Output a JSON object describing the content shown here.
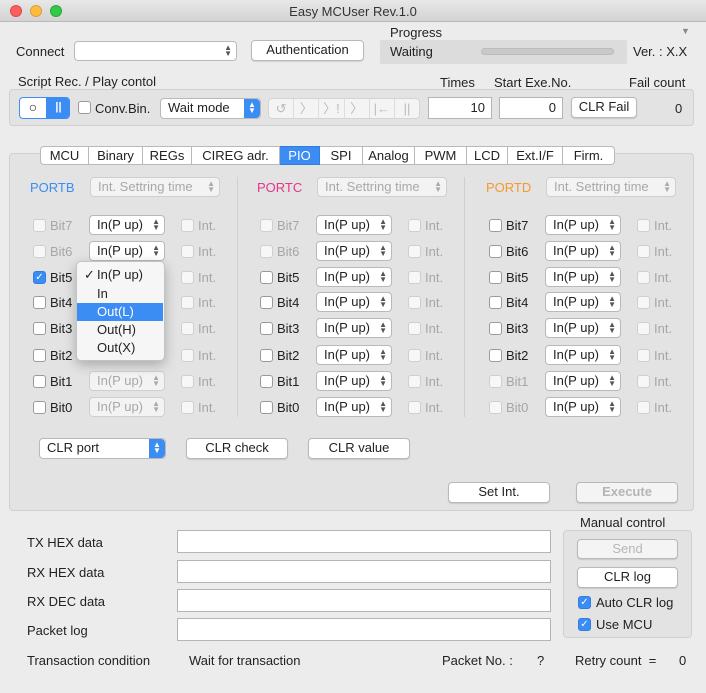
{
  "window": {
    "title": "Easy MCUser Rev.1.0"
  },
  "header": {
    "connect_label": "Connect",
    "connect_value": "",
    "auth_button": "Authentication",
    "progress_label": "Progress",
    "progress_status": "Waiting",
    "progress_fraction": 0,
    "version": "Ver. : X.X"
  },
  "script": {
    "label": "Script Rec. / Play contol",
    "times_label": "Times",
    "start_label": "Start Exe.No.",
    "fail_label": "Fail count",
    "conv_label": "Conv.Bin.",
    "mode_value": "Wait mode",
    "times_value": "10",
    "start_value": "0",
    "clr_fail": "CLR Fail",
    "fail_value": "0",
    "record_icon": "○",
    "pause_icon": "||",
    "transport": [
      "↺",
      "〉",
      "〉!",
      "〉",
      "|←",
      "||"
    ]
  },
  "tabs": [
    "MCU",
    "Binary",
    "REGs",
    "CIREG adr.",
    "PIO",
    "SPI",
    "Analog",
    "PWM",
    "LCD",
    "Ext.I/F",
    "Firm."
  ],
  "active_tab": "PIO",
  "pio": {
    "int_label": "Int.",
    "setting_placeholder": "Int. Settring time",
    "ports": [
      {
        "name": "PORTB",
        "color": "#3b8cf3",
        "rows": [
          {
            "bit": "Bit7",
            "checked": false,
            "enabled": false,
            "mode": "In(P up)",
            "mode_enabled": true
          },
          {
            "bit": "Bit6",
            "checked": false,
            "enabled": false,
            "mode": "In(P up)",
            "mode_enabled": true
          },
          {
            "bit": "Bit5",
            "checked": true,
            "enabled": true,
            "mode": "",
            "mode_enabled": true
          },
          {
            "bit": "Bit4",
            "checked": false,
            "enabled": true,
            "mode": "",
            "mode_enabled": true
          },
          {
            "bit": "Bit3",
            "checked": false,
            "enabled": true,
            "mode": "",
            "mode_enabled": true
          },
          {
            "bit": "Bit2",
            "checked": false,
            "enabled": true,
            "mode": "",
            "mode_enabled": true
          },
          {
            "bit": "Bit1",
            "checked": false,
            "enabled": true,
            "mode": "In(P up)",
            "mode_enabled": false
          },
          {
            "bit": "Bit0",
            "checked": false,
            "enabled": true,
            "mode": "In(P up)",
            "mode_enabled": false
          }
        ]
      },
      {
        "name": "PORTC",
        "color": "#e6358c",
        "rows": [
          {
            "bit": "Bit7",
            "checked": false,
            "enabled": false,
            "mode": "In(P up)",
            "mode_enabled": true
          },
          {
            "bit": "Bit6",
            "checked": false,
            "enabled": false,
            "mode": "In(P up)",
            "mode_enabled": true
          },
          {
            "bit": "Bit5",
            "checked": false,
            "enabled": true,
            "mode": "In(P up)",
            "mode_enabled": true
          },
          {
            "bit": "Bit4",
            "checked": false,
            "enabled": true,
            "mode": "In(P up)",
            "mode_enabled": true
          },
          {
            "bit": "Bit3",
            "checked": false,
            "enabled": true,
            "mode": "In(P up)",
            "mode_enabled": true
          },
          {
            "bit": "Bit2",
            "checked": false,
            "enabled": true,
            "mode": "In(P up)",
            "mode_enabled": true
          },
          {
            "bit": "Bit1",
            "checked": false,
            "enabled": true,
            "mode": "In(P up)",
            "mode_enabled": true
          },
          {
            "bit": "Bit0",
            "checked": false,
            "enabled": true,
            "mode": "In(P up)",
            "mode_enabled": true
          }
        ]
      },
      {
        "name": "PORTD",
        "color": "#f39a2e",
        "rows": [
          {
            "bit": "Bit7",
            "checked": false,
            "enabled": true,
            "mode": "In(P up)",
            "mode_enabled": true
          },
          {
            "bit": "Bit6",
            "checked": false,
            "enabled": true,
            "mode": "In(P up)",
            "mode_enabled": true
          },
          {
            "bit": "Bit5",
            "checked": false,
            "enabled": true,
            "mode": "In(P up)",
            "mode_enabled": true
          },
          {
            "bit": "Bit4",
            "checked": false,
            "enabled": true,
            "mode": "In(P up)",
            "mode_enabled": true
          },
          {
            "bit": "Bit3",
            "checked": false,
            "enabled": true,
            "mode": "In(P up)",
            "mode_enabled": true
          },
          {
            "bit": "Bit2",
            "checked": false,
            "enabled": true,
            "mode": "In(P up)",
            "mode_enabled": true
          },
          {
            "bit": "Bit1",
            "checked": false,
            "enabled": false,
            "mode": "In(P up)",
            "mode_enabled": true
          },
          {
            "bit": "Bit0",
            "checked": false,
            "enabled": false,
            "mode": "In(P up)",
            "mode_enabled": true
          }
        ]
      }
    ],
    "dropdown": {
      "items": [
        "In(P up)",
        "In",
        "Out(L)",
        "Out(H)",
        "Out(X)"
      ],
      "checked_index": 0,
      "highlighted_index": 2,
      "checkmark": "✓"
    },
    "clr_port": "CLR port",
    "clr_check": "CLR check",
    "clr_value": "CLR value",
    "set_int": "Set Int.",
    "execute": "Execute"
  },
  "bottom": {
    "fields": [
      {
        "label": "TX HEX data",
        "value": ""
      },
      {
        "label": "RX HEX data",
        "value": ""
      },
      {
        "label": "RX DEC data",
        "value": ""
      },
      {
        "label": "Packet log",
        "value": ""
      }
    ],
    "manual_label": "Manual control",
    "send": "Send",
    "clr_log": "CLR log",
    "auto_clr": "Auto CLR log",
    "use_mcu": "Use MCU",
    "trans_label": "Transaction condition",
    "trans_value": "Wait for transaction",
    "packet_label": "Packet No. :",
    "packet_value": "?",
    "retry_label": "Retry count  =",
    "retry_value": "0"
  },
  "colors": {
    "accent": "#3b8cf3",
    "close": "#fc605c",
    "minimize": "#fdbc40",
    "zoom": "#34c84a"
  }
}
